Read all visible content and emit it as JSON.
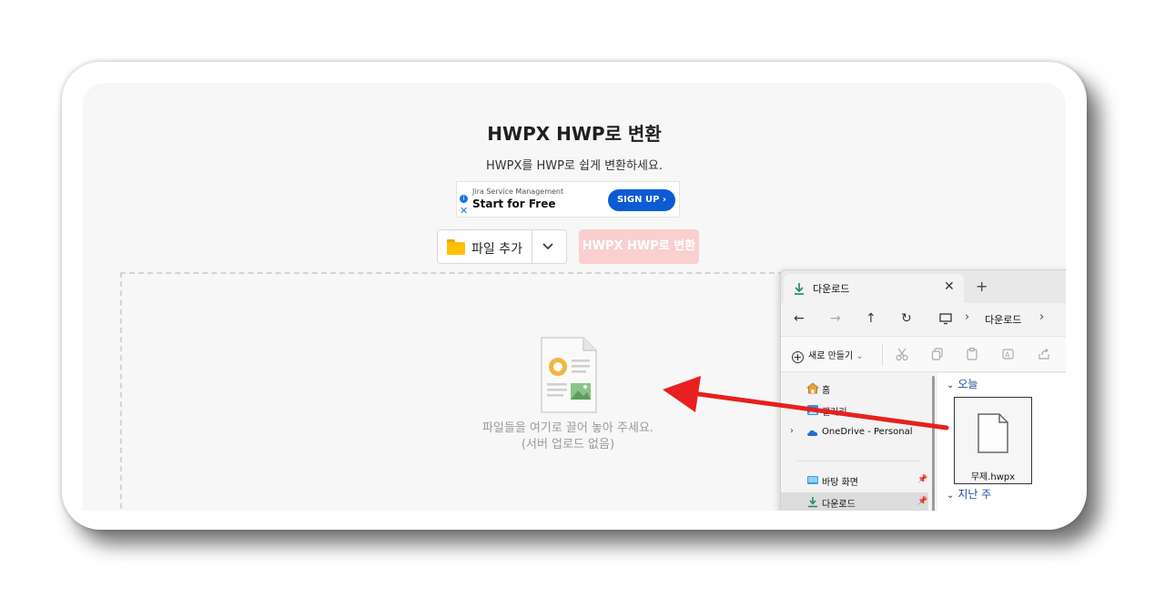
{
  "page": {
    "title": "HWPX HWP로 변환",
    "subtitle": "HWPX를 HWP로 쉽게 변환하세요."
  },
  "ad": {
    "small_text": "Jira Service Management",
    "headline": "Start for Free",
    "button": "SIGN UP ›"
  },
  "controls": {
    "add_file_label": "파일 추가",
    "convert_label": "HWPX HWP로 변환"
  },
  "dropzone": {
    "line1": "파일들을 여기로 끌어 놓아 주세요.",
    "line2": "(서버 업로드 없음)"
  },
  "explorer": {
    "tab_title": "다운로드",
    "address": "다운로드",
    "new_button": "새로 만들기",
    "nav_items": [
      {
        "label": "홈",
        "icon": "home-icon"
      },
      {
        "label": "갤러리",
        "icon": "gallery-icon"
      },
      {
        "label": "OneDrive - Personal",
        "icon": "cloud-icon"
      },
      {
        "label": "바탕 화면",
        "icon": "desktop-icon"
      },
      {
        "label": "다운로드",
        "icon": "download-icon"
      }
    ],
    "groups": {
      "today": "오늘",
      "last_week": "지난 주"
    },
    "file_name": "무제.hwpx"
  },
  "colors": {
    "accent_blue": "#0b5bd3",
    "convert_disabled": "#f9cfcf",
    "arrow_red": "#e8201f"
  }
}
